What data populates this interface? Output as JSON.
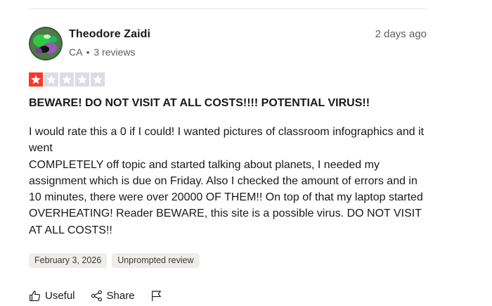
{
  "reviewer": {
    "name": "Theodore Zaidi",
    "country": "CA",
    "separator": "•",
    "review_count": "3 reviews",
    "avatar_icon": "avatar-photo-icon"
  },
  "review": {
    "date_relative": "2 days ago",
    "rating": 1,
    "rating_max": 5,
    "rating_color": "#ff3722",
    "empty_star_color": "#dcdce6",
    "title": "BEWARE! DO NOT VISIT AT ALL COSTS!!!! POTENTIAL VIRUS!!",
    "body_line_1": "I would rate this a 0 if I could! I wanted pictures of classroom infographics and it went",
    "body_line_2": "COMPLETELY off topic and started talking about planets, I needed my assignment which is due on Friday. Also I checked the amount of errors and in 10 minutes, there were over 20000 OF THEM!! On top of that my laptop started OVERHEATING! Reader BEWARE, this site is a possible virus. DO NOT VISIT AT ALL COSTS!!",
    "tags": [
      "February 3, 2026",
      "Unprompted review"
    ]
  },
  "actions": {
    "useful_label": "Useful",
    "useful_icon": "thumbs-up-icon",
    "share_label": "Share",
    "share_icon": "share-icon",
    "report_icon": "flag-icon"
  }
}
